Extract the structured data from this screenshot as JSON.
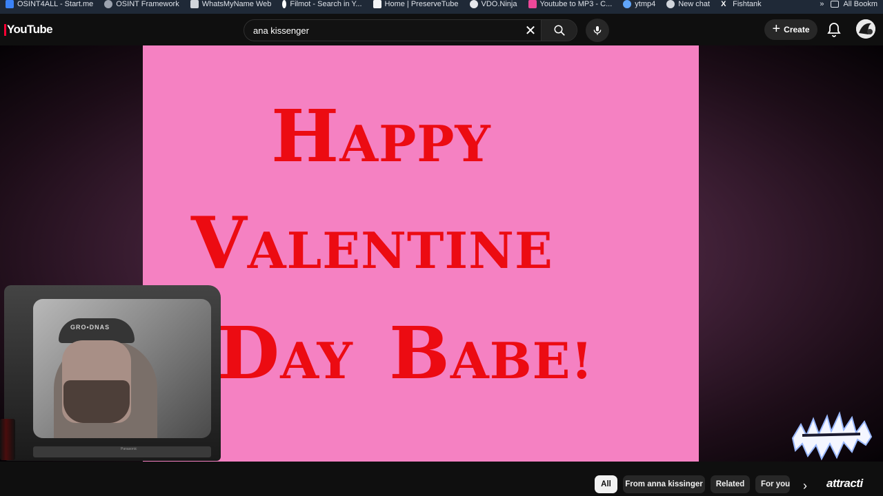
{
  "bookmarks": [
    {
      "label": "OSINT4ALL - Start.me",
      "color": "#3b82f6"
    },
    {
      "label": "OSINT Framework",
      "color": "#9ca3af"
    },
    {
      "label": "WhatsMyName Web",
      "color": "#d1d5db"
    },
    {
      "label": "Filmot - Search in Y...",
      "color": "#ffffff"
    },
    {
      "label": "Home | PreserveTube",
      "color": "#f3f4f6"
    },
    {
      "label": "VDO.Ninja",
      "color": "#e5e7eb"
    },
    {
      "label": "Youtube to MP3 - C...",
      "color": "#ec4899"
    },
    {
      "label": "ytmp4",
      "color": "#60a5fa"
    },
    {
      "label": "New chat",
      "color": "#d1d5db"
    },
    {
      "label": "Fishtank",
      "color": "#e5e7eb"
    }
  ],
  "bookmarks_more": "»",
  "bookmarks_all": "All Bookm",
  "header": {
    "logo": "YouTube",
    "search_value": "ana kissenger",
    "clear": "✕",
    "create": "Create",
    "create_plus": "+"
  },
  "video": {
    "line1_big1": "H",
    "line1_small": "APPY",
    "line2_big1": "V",
    "line2_small": "ALENTINE",
    "line3_big1": "D",
    "line3_small1": "AY  ",
    "line3_big2": "B",
    "line3_small2": "ABE!",
    "tv_hat_text": "GRO•DNAS",
    "tv_brand": "Panasonic"
  },
  "chips": [
    {
      "label": "All",
      "active": true
    },
    {
      "label": "From anna kissinger",
      "active": false
    },
    {
      "label": "Related",
      "active": false
    },
    {
      "label": "For you",
      "active": false
    }
  ],
  "chip_next": "›",
  "watermark": "attracti",
  "colors": {
    "card": "#f581c2",
    "text_red": "#ec0b12",
    "brand_red": "#ff0033"
  }
}
